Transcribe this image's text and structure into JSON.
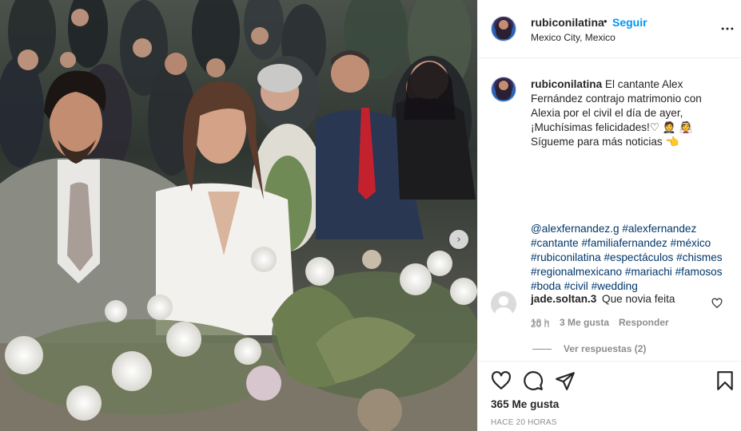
{
  "post": {
    "username": "rubiconilatina",
    "follow_label": "Seguir",
    "location": "Mexico City, Mexico"
  },
  "caption": {
    "username": "rubiconilatina",
    "text_line1": "El cantante Alex Fernández contrajo matrimonio con Alexia por el civil el día de ayer, ¡Muchísimas felicidades!",
    "emoji_1": "♡",
    "emoji_2": "🤵",
    "emoji_3": "👰",
    "text_line2": "Sígueme para más noticias",
    "emoji_4": "👈",
    "hashtags": [
      "@alexfernandez.g",
      "#alexfernandez",
      "#cantante",
      "#familiafernandez",
      "#méxico",
      "#rubiconilatina",
      "#espectáculos",
      "#chismes",
      "#regionalmexicano",
      "#mariachi",
      "#famosos",
      "#boda",
      "#civil",
      "#wedding"
    ],
    "time": "20 h"
  },
  "comment": {
    "username": "jade.soltan.3",
    "text": "Que novia feita",
    "time": "18 h",
    "likes": "3 Me gusta",
    "reply_label": "Responder",
    "view_replies": "Ver respuestas (2)"
  },
  "footer": {
    "likes": "365 Me gusta",
    "posted": "HACE 20 HORAS"
  },
  "icons": {
    "more": "more-options-icon",
    "like": "heart-icon",
    "comment": "comment-bubble-icon",
    "share": "paper-plane-icon",
    "save": "bookmark-icon",
    "next": "chevron-right-icon"
  },
  "colors": {
    "link": "#0095f6",
    "hashtag": "#00376b",
    "secondary_text": "#8e8e8e",
    "primary_text": "#262626"
  }
}
